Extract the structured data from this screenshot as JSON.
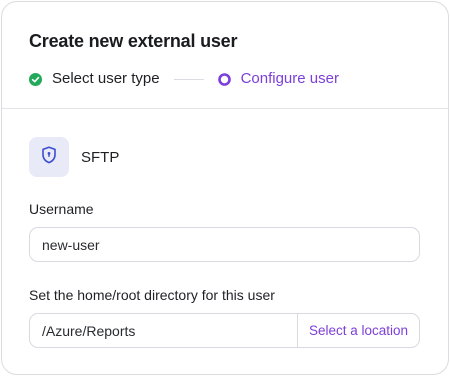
{
  "dialog": {
    "title": "Create new external user"
  },
  "stepper": {
    "steps": [
      {
        "label": "Select user type",
        "status": "completed",
        "icon": "check-circle-icon"
      },
      {
        "label": "Configure user",
        "status": "active",
        "icon": "radio-active-icon"
      }
    ]
  },
  "user_type": {
    "label": "SFTP",
    "icon": "shield-lock-icon"
  },
  "username": {
    "label": "Username",
    "value": "new-user"
  },
  "directory": {
    "label": "Set the home/root directory for this user",
    "value": "/Azure/Reports",
    "button_label": "Select a location"
  },
  "colors": {
    "accent": "#7d3fd9",
    "success": "#22a95a",
    "icon_bg": "#e8eaf8",
    "icon_fg": "#3b4fcf"
  }
}
